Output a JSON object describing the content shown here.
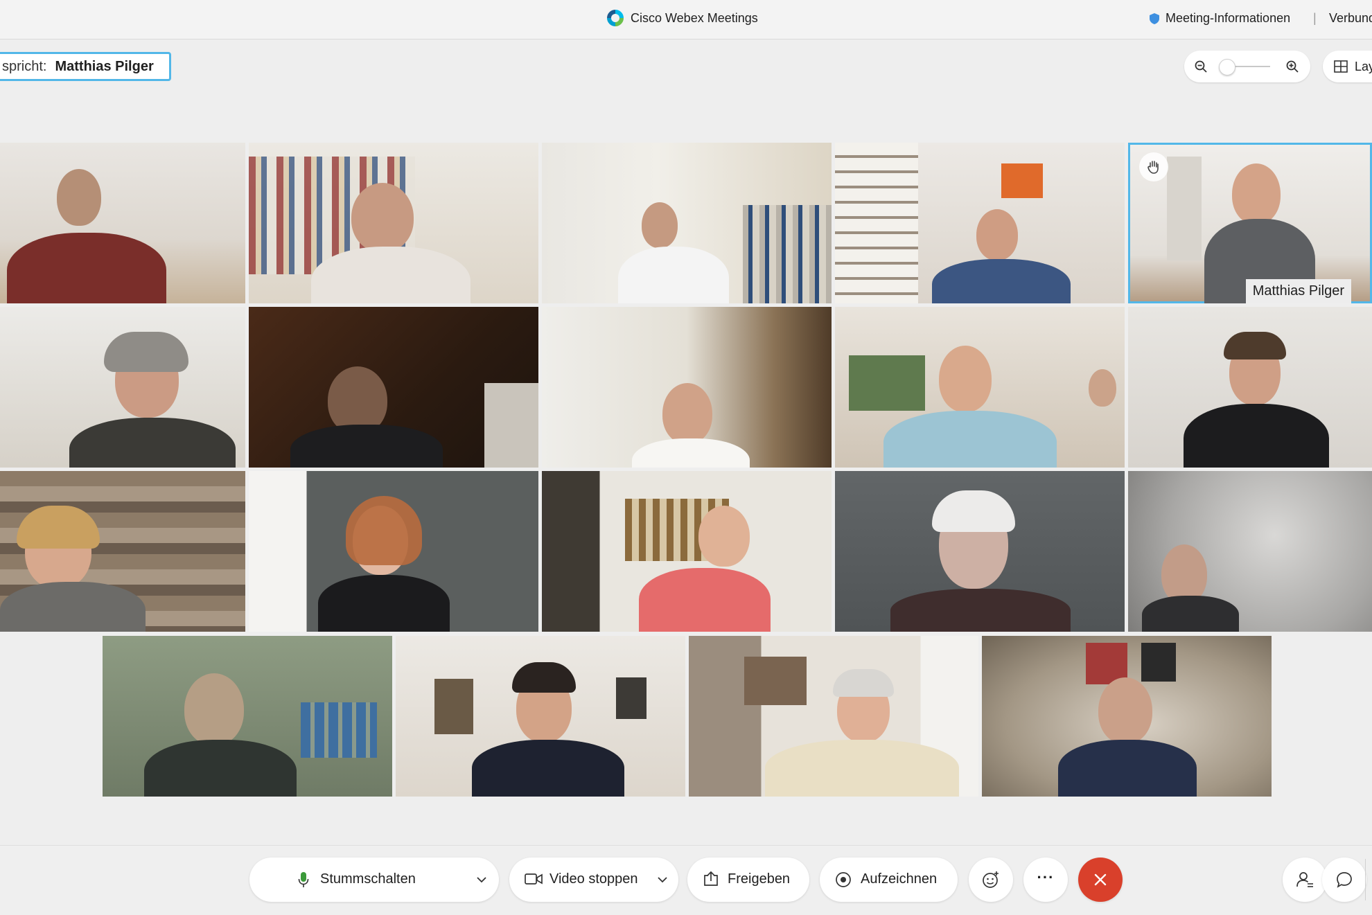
{
  "titlebar": {
    "app_title": "Cisco Webex Meetings",
    "meeting_info": "Meeting-Informationen",
    "separator": "|",
    "connection": "Verbunden"
  },
  "speaking": {
    "label": "spricht:",
    "name": "Matthias Pilger"
  },
  "zoom": {
    "level": 0.1
  },
  "layout": {
    "label": "Layout"
  },
  "active_speaker": {
    "name": "Matthias Pilger"
  },
  "toolbar": {
    "mute_label": "Stummschalten",
    "video_label": "Video stoppen",
    "share_label": "Freigeben",
    "record_label": "Aufzeichnen",
    "more_label": "···"
  },
  "colors": {
    "accent": "#52b7e8",
    "end_call": "#d9402b"
  }
}
